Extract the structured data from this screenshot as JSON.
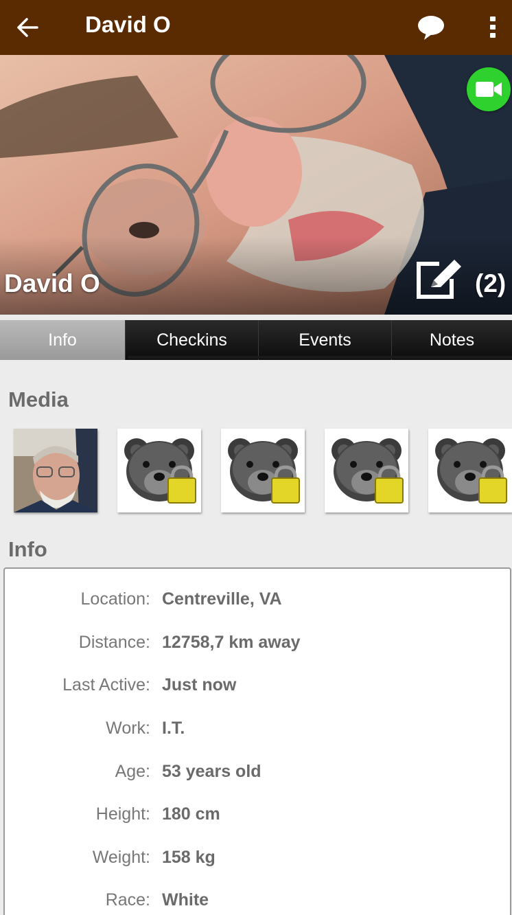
{
  "appbar": {
    "back_icon": "arrow-left-icon",
    "title": "David O",
    "chat_icon": "speech-bubble-icon",
    "more_icon": "more-vertical-icon",
    "background_color": "#5a2a00"
  },
  "cover": {
    "name": "David O",
    "count": "(2)",
    "video_icon": "video-camera-icon",
    "video_button_color": "#2ed12e",
    "edit_icon": "edit-note-icon"
  },
  "tabs": [
    {
      "label": "Info",
      "active": true
    },
    {
      "label": "Checkins",
      "active": false
    },
    {
      "label": "Events",
      "active": false
    },
    {
      "label": "Notes",
      "active": false
    }
  ],
  "media": {
    "title": "Media",
    "items": [
      {
        "type": "photo",
        "locked": false
      },
      {
        "type": "bear-placeholder",
        "locked": true,
        "icon": "locked-bear-icon"
      },
      {
        "type": "bear-placeholder",
        "locked": true,
        "icon": "locked-bear-icon"
      },
      {
        "type": "bear-placeholder",
        "locked": true,
        "icon": "locked-bear-icon"
      },
      {
        "type": "bear-placeholder",
        "locked": true,
        "icon": "locked-bear-icon"
      }
    ]
  },
  "info": {
    "title": "Info",
    "rows": [
      {
        "label": "Location:",
        "value": "Centreville, VA"
      },
      {
        "label": "Distance:",
        "value": "12758,7 km away"
      },
      {
        "label": "Last Active:",
        "value": "Just now"
      },
      {
        "label": "Work:",
        "value": "I.T."
      },
      {
        "label": "Age:",
        "value": "53 years old"
      },
      {
        "label": "Height:",
        "value": "180 cm"
      },
      {
        "label": "Weight:",
        "value": "158 kg"
      },
      {
        "label": "Race:",
        "value": "White"
      }
    ]
  }
}
